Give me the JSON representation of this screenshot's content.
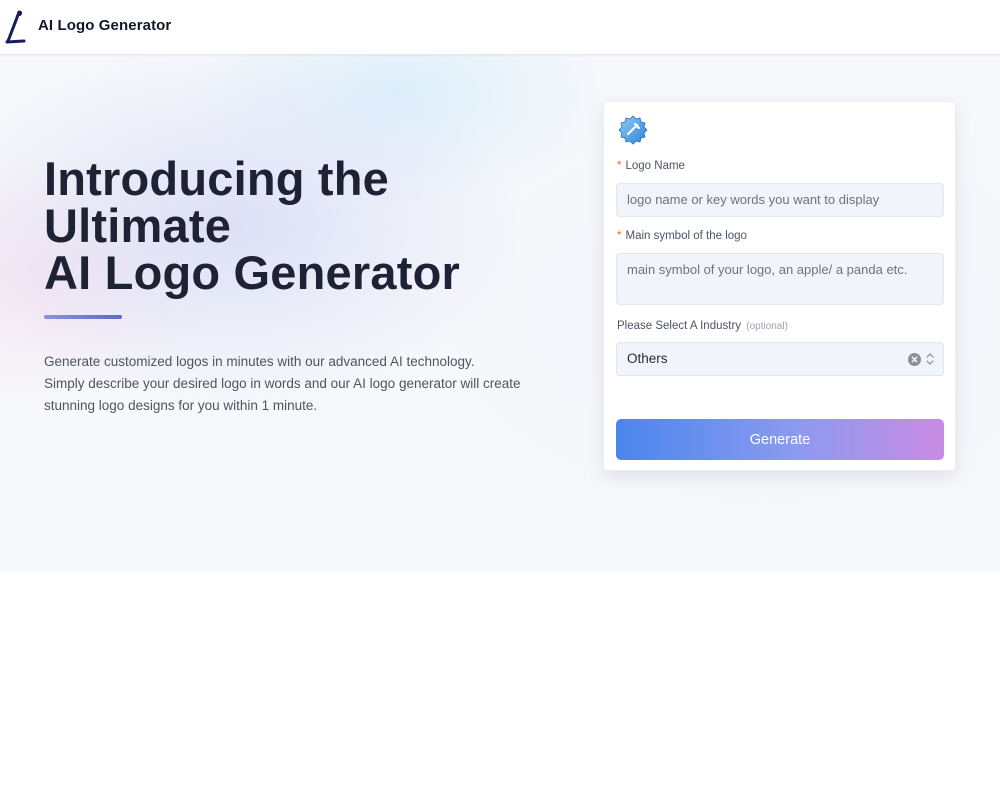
{
  "app": {
    "brand_name": "AI Logo Generator",
    "brand_icon": "letter-L-logo-icon"
  },
  "hero": {
    "title_lines": [
      "Introducing the",
      "Ultimate",
      "AI Logo Generator"
    ],
    "description_lines": [
      "Generate customized logos in minutes with our advanced AI technology.",
      "Simply describe your desired logo in words and our AI logo generator will create",
      "stunning logo designs for you within 1 minute."
    ]
  },
  "form": {
    "icon": "gear-badge-icon",
    "logo_name": {
      "required_mark": "*",
      "label": "Logo Name",
      "placeholder": "logo name or key words you want to display",
      "value": ""
    },
    "main_symbol": {
      "required_mark": "*",
      "label": "Main symbol of the logo",
      "placeholder": "main symbol of your logo, an apple/ a panda etc.",
      "value": ""
    },
    "industry": {
      "label": "Please Select A Industry",
      "optional_tag": "(optional)",
      "selected": "Others"
    },
    "generate_label": "Generate"
  },
  "colors": {
    "title": "#1e2235",
    "required": "#ef6a2a",
    "button_start": "#4a86ec",
    "button_end": "#c98be3"
  }
}
